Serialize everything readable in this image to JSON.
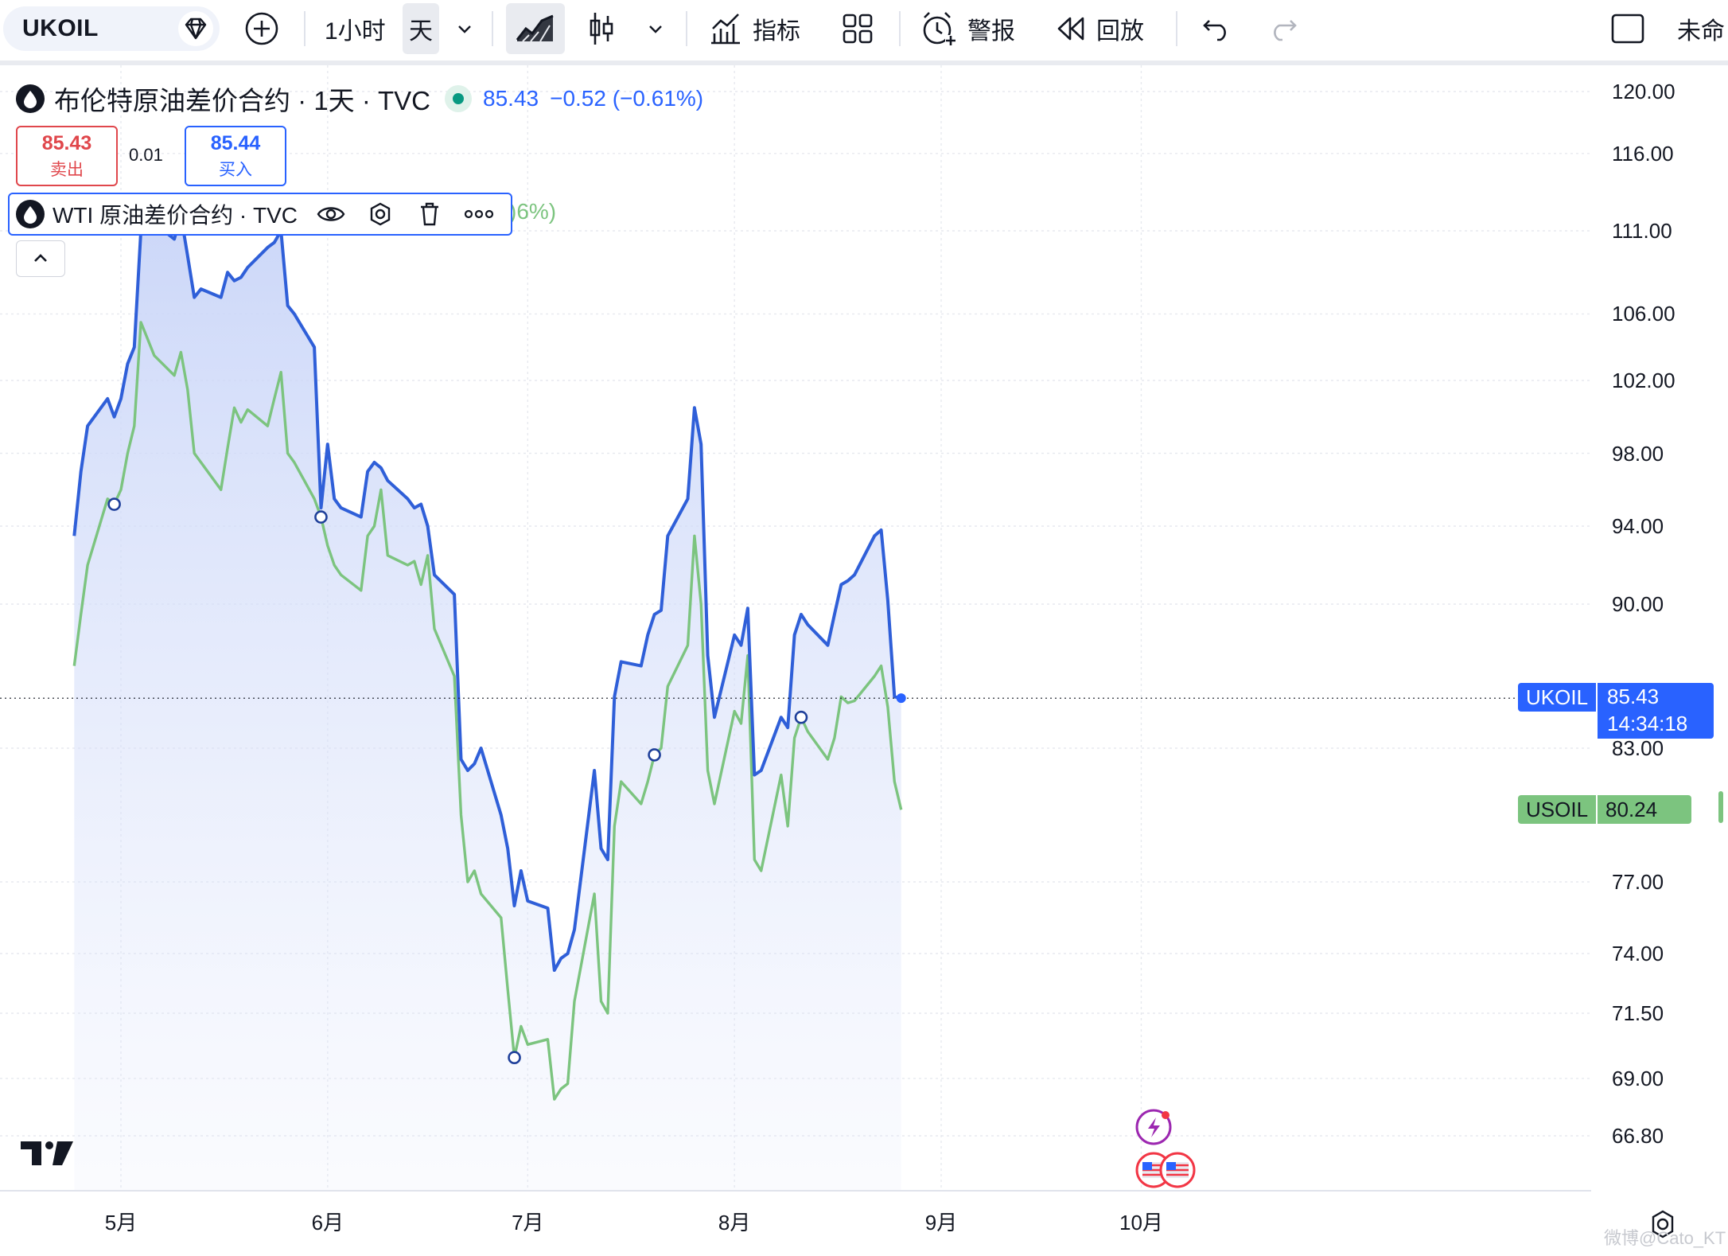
{
  "toolbar": {
    "symbol": "UKOIL",
    "timeframe_1h": "1小时",
    "timeframe_day": "天",
    "indicators_label": "指标",
    "alerts_label": "警报",
    "replay_label": "回放",
    "layout_name": "未命"
  },
  "legend": {
    "main_title": "布伦特原油差价合约 · 1天 · TVC",
    "main_value": "85.43",
    "main_change": "−0.52 (−0.61%)",
    "sell_price": "85.43",
    "sell_label": "卖出",
    "spread": "0.01",
    "buy_price": "85.44",
    "buy_label": "买入",
    "wti_title": "WTI 原油差价合约 · TVC",
    "wti_pct_fragment": ")6%)"
  },
  "price_badges": {
    "ukoil_name": "UKOIL",
    "ukoil_price": "85.43",
    "ukoil_countdown": "14:34:18",
    "usoil_name": "USOIL",
    "usoil_price": "80.24"
  },
  "watermark": "微博@Cato_KT",
  "colors": {
    "ukoil_line": "#2f5fd8",
    "usoil_line": "#7cc47f",
    "fill_top": "#c9d5f8",
    "accent": "#2962ff",
    "sell": "#e0474c",
    "grid": "#e7e9ef"
  },
  "chart_data": {
    "type": "line",
    "y_axis_ticks": [
      "120.00",
      "116.00",
      "111.00",
      "106.00",
      "102.00",
      "98.00",
      "94.00",
      "90.00",
      "83.00",
      "77.00",
      "74.00",
      "71.50",
      "69.00",
      "66.80"
    ],
    "x_axis_ticks": [
      "5月",
      "6月",
      "7月",
      "8月",
      "9月",
      "10月"
    ],
    "series": [
      {
        "name": "UKOIL",
        "points": [
          [
            "04-24",
            93.5
          ],
          [
            "04-25",
            97.0
          ],
          [
            "04-26",
            99.5
          ],
          [
            "04-29",
            101.0
          ],
          [
            "04-30",
            100.0
          ],
          [
            "05-01",
            101.0
          ],
          [
            "05-02",
            103.0
          ],
          [
            "05-03",
            104.0
          ],
          [
            "05-04",
            111.0
          ],
          [
            "05-05",
            112.0
          ],
          [
            "05-06",
            111.5
          ],
          [
            "05-09",
            110.5
          ],
          [
            "05-10",
            112.0
          ],
          [
            "05-11",
            109.5
          ],
          [
            "05-12",
            107.0
          ],
          [
            "05-13",
            107.5
          ],
          [
            "05-16",
            107.0
          ],
          [
            "05-17",
            108.5
          ],
          [
            "05-18",
            108.0
          ],
          [
            "05-19",
            108.2
          ],
          [
            "05-20",
            108.8
          ],
          [
            "05-23",
            110.0
          ],
          [
            "05-24",
            110.3
          ],
          [
            "05-25",
            111.0
          ],
          [
            "05-26",
            106.5
          ],
          [
            "05-27",
            106.0
          ],
          [
            "05-30",
            104.0
          ],
          [
            "05-31",
            95.0
          ],
          [
            "06-01",
            98.5
          ],
          [
            "06-02",
            95.5
          ],
          [
            "06-03",
            95.0
          ],
          [
            "06-06",
            94.5
          ],
          [
            "06-07",
            97.0
          ],
          [
            "06-08",
            97.5
          ],
          [
            "06-09",
            97.2
          ],
          [
            "06-10",
            96.5
          ],
          [
            "06-13",
            95.5
          ],
          [
            "06-14",
            95.0
          ],
          [
            "06-15",
            95.2
          ],
          [
            "06-16",
            94.0
          ],
          [
            "06-17",
            91.5
          ],
          [
            "06-20",
            90.5
          ],
          [
            "06-21",
            82.5
          ],
          [
            "06-22",
            82.0
          ],
          [
            "06-23",
            82.3
          ],
          [
            "06-24",
            83.0
          ],
          [
            "06-27",
            80.0
          ],
          [
            "06-28",
            78.5
          ],
          [
            "06-29",
            76.0
          ],
          [
            "06-30",
            77.5
          ],
          [
            "07-01",
            76.2
          ],
          [
            "07-04",
            75.9
          ],
          [
            "07-05",
            73.3
          ],
          [
            "07-06",
            73.8
          ],
          [
            "07-07",
            74.0
          ],
          [
            "07-08",
            75.0
          ],
          [
            "07-11",
            82.0
          ],
          [
            "07-12",
            78.5
          ],
          [
            "07-13",
            78.0
          ],
          [
            "07-14",
            85.5
          ],
          [
            "07-15",
            87.2
          ],
          [
            "07-18",
            87.0
          ],
          [
            "07-19",
            88.5
          ],
          [
            "07-20",
            89.5
          ],
          [
            "07-21",
            89.7
          ],
          [
            "07-22",
            93.5
          ],
          [
            "07-25",
            95.5
          ],
          [
            "07-26",
            100.5
          ],
          [
            "07-27",
            98.5
          ],
          [
            "07-28",
            87.5
          ],
          [
            "07-29",
            84.5
          ],
          [
            "08-01",
            88.5
          ],
          [
            "08-02",
            88.0
          ],
          [
            "08-03",
            89.8
          ],
          [
            "08-04",
            81.8
          ],
          [
            "08-05",
            82.0
          ],
          [
            "08-08",
            84.5
          ],
          [
            "08-09",
            84.0
          ],
          [
            "08-10",
            88.5
          ],
          [
            "08-11",
            89.5
          ],
          [
            "08-12",
            89.0
          ],
          [
            "08-15",
            88.0
          ],
          [
            "08-16",
            89.5
          ],
          [
            "08-17",
            91.0
          ],
          [
            "08-18",
            91.2
          ],
          [
            "08-19",
            91.5
          ],
          [
            "08-22",
            93.5
          ],
          [
            "08-23",
            93.8
          ],
          [
            "08-24",
            90.2
          ],
          [
            "08-25",
            85.5
          ],
          [
            "08-26",
            85.43
          ]
        ]
      },
      {
        "name": "USOIL",
        "points": [
          [
            "04-24",
            87.0
          ],
          [
            "04-25",
            89.5
          ],
          [
            "04-26",
            92.0
          ],
          [
            "04-29",
            95.5
          ],
          [
            "04-30",
            95.2
          ],
          [
            "05-01",
            96.0
          ],
          [
            "05-02",
            98.0
          ],
          [
            "05-03",
            99.5
          ],
          [
            "05-04",
            105.5
          ],
          [
            "05-05",
            104.5
          ],
          [
            "05-06",
            103.5
          ],
          [
            "05-09",
            102.3
          ],
          [
            "05-10",
            103.7
          ],
          [
            "05-11",
            101.5
          ],
          [
            "05-12",
            98.0
          ],
          [
            "05-13",
            97.5
          ],
          [
            "05-16",
            96.0
          ],
          [
            "05-17",
            98.3
          ],
          [
            "05-18",
            100.5
          ],
          [
            "05-19",
            99.7
          ],
          [
            "05-20",
            100.4
          ],
          [
            "05-23",
            99.5
          ],
          [
            "05-24",
            101.0
          ],
          [
            "05-25",
            102.5
          ],
          [
            "05-26",
            98.0
          ],
          [
            "05-27",
            97.5
          ],
          [
            "05-30",
            95.5
          ],
          [
            "05-31",
            94.5
          ],
          [
            "06-01",
            93.0
          ],
          [
            "06-02",
            92.0
          ],
          [
            "06-03",
            91.5
          ],
          [
            "06-06",
            90.7
          ],
          [
            "06-07",
            93.5
          ],
          [
            "06-08",
            94.0
          ],
          [
            "06-09",
            96.0
          ],
          [
            "06-10",
            92.5
          ],
          [
            "06-13",
            92.0
          ],
          [
            "06-14",
            92.2
          ],
          [
            "06-15",
            91.0
          ],
          [
            "06-16",
            92.5
          ],
          [
            "06-17",
            88.8
          ],
          [
            "06-20",
            86.5
          ],
          [
            "06-21",
            80.0
          ],
          [
            "06-22",
            77.0
          ],
          [
            "06-23",
            77.5
          ],
          [
            "06-24",
            76.5
          ],
          [
            "06-27",
            75.5
          ],
          [
            "06-28",
            72.5
          ],
          [
            "06-29",
            69.8
          ],
          [
            "06-30",
            71.0
          ],
          [
            "07-01",
            70.3
          ],
          [
            "07-04",
            70.5
          ],
          [
            "07-05",
            68.2
          ],
          [
            "07-06",
            68.6
          ],
          [
            "07-07",
            68.8
          ],
          [
            "07-08",
            72.0
          ],
          [
            "07-11",
            76.5
          ],
          [
            "07-12",
            72.0
          ],
          [
            "07-13",
            71.5
          ],
          [
            "07-14",
            79.5
          ],
          [
            "07-15",
            81.5
          ],
          [
            "07-18",
            80.5
          ],
          [
            "07-19",
            81.5
          ],
          [
            "07-20",
            82.7
          ],
          [
            "07-21",
            83.0
          ],
          [
            "07-22",
            86.0
          ],
          [
            "07-25",
            88.0
          ],
          [
            "07-26",
            93.5
          ],
          [
            "07-27",
            90.0
          ],
          [
            "07-28",
            82.0
          ],
          [
            "07-29",
            80.5
          ],
          [
            "08-01",
            84.8
          ],
          [
            "08-02",
            84.2
          ],
          [
            "08-03",
            87.5
          ],
          [
            "08-04",
            78.0
          ],
          [
            "08-05",
            77.5
          ],
          [
            "08-08",
            81.8
          ],
          [
            "08-09",
            79.5
          ],
          [
            "08-10",
            83.5
          ],
          [
            "08-11",
            84.5
          ],
          [
            "08-12",
            83.8
          ],
          [
            "08-15",
            82.5
          ],
          [
            "08-16",
            83.5
          ],
          [
            "08-17",
            85.5
          ],
          [
            "08-18",
            85.2
          ],
          [
            "08-19",
            85.3
          ],
          [
            "08-22",
            86.5
          ],
          [
            "08-23",
            87.0
          ],
          [
            "08-24",
            85.0
          ],
          [
            "08-25",
            81.5
          ],
          [
            "08-26",
            80.24
          ]
        ]
      }
    ]
  }
}
